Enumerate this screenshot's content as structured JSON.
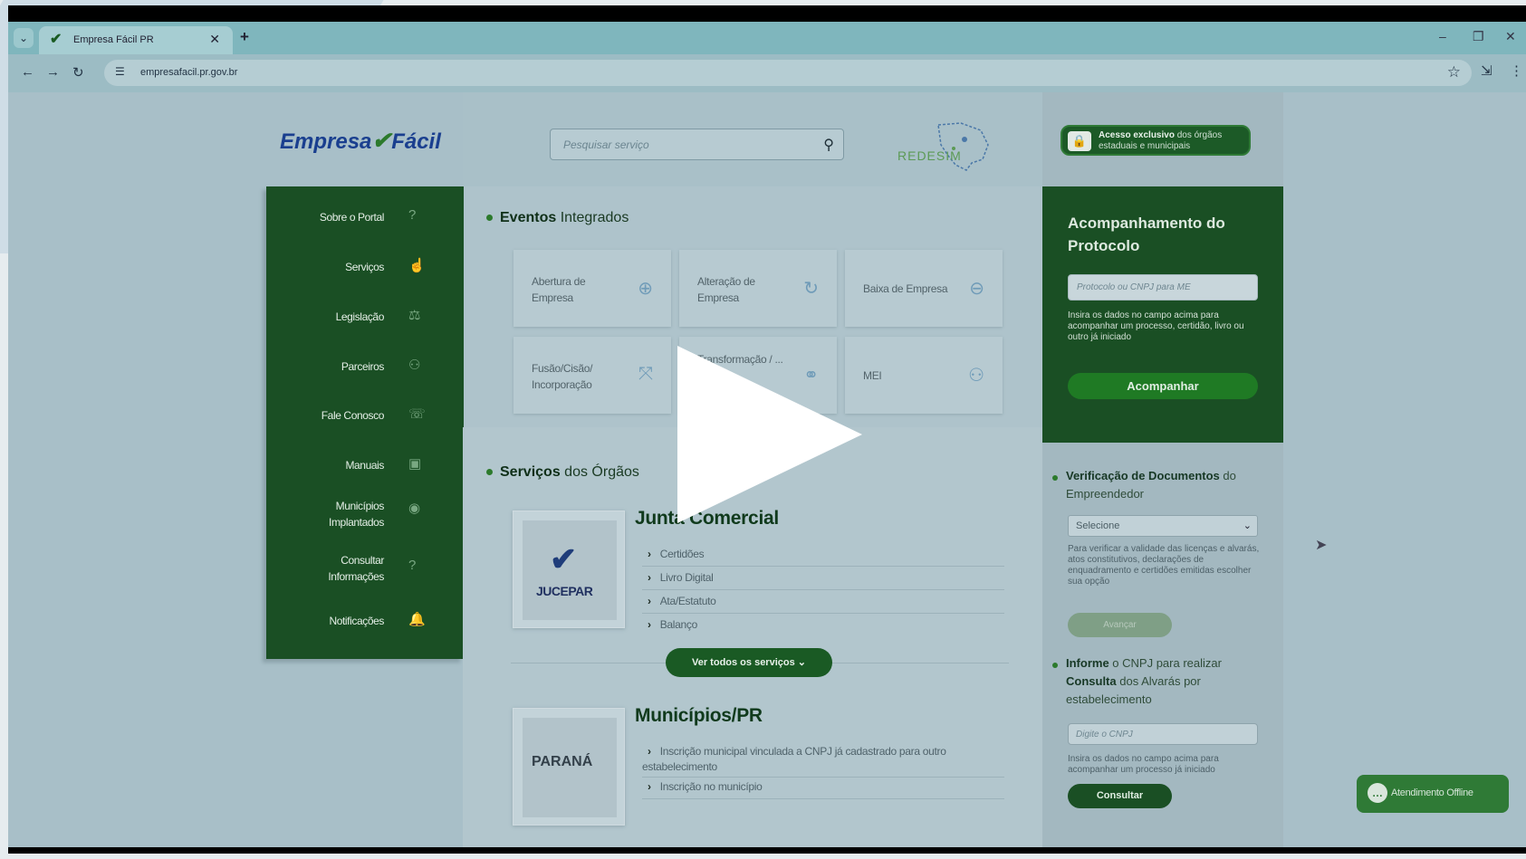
{
  "browser": {
    "tab_title": "Empresa Fácil PR",
    "url": "empresafacil.pr.gov.br"
  },
  "header": {
    "logo_part1": "Empresa",
    "logo_part2": "Fácil",
    "search_placeholder": "Pesquisar serviço",
    "redesim_label": "REDESIM",
    "acesso_bold": "Acesso exclusivo",
    "acesso_rest": "dos órgãos estaduais e municipais"
  },
  "sidebar": {
    "items": [
      {
        "label": "Sobre o Portal",
        "icon": "?"
      },
      {
        "label": "Serviços",
        "icon": "☝"
      },
      {
        "label": "Legislação",
        "icon": "⚖"
      },
      {
        "label": "Parceiros",
        "icon": "⚇"
      },
      {
        "label": "Fale Conosco",
        "icon": "☏"
      },
      {
        "label": "Manuais",
        "icon": "▣"
      },
      {
        "label": "Municípios Implantados",
        "icon": "◉"
      },
      {
        "label": "Consultar Informações",
        "icon": "?"
      },
      {
        "label": "Notificações",
        "icon": "🔔"
      }
    ]
  },
  "eventos": {
    "title_bold": "Eventos",
    "title_rest": "Integrados",
    "cards": [
      {
        "label": "Abertura de Empresa",
        "icon": "⊕"
      },
      {
        "label": "Alteração de Empresa",
        "icon": "↻"
      },
      {
        "label": "Baixa de Empresa",
        "icon": "⊖"
      },
      {
        "label": "Fusão/Cisão/ Incorporação",
        "icon": "⤧"
      },
      {
        "label": "Transformação / ... de ...",
        "icon": "⚭"
      },
      {
        "label": "MEI",
        "icon": "⚇"
      }
    ]
  },
  "orgaos": {
    "title_bold": "Serviços",
    "title_rest": "dos Órgãos",
    "junta": {
      "title": "Junta Comercial",
      "logo_text": "JUCEPAR",
      "links": [
        "Certidões",
        "Livro Digital",
        "Ata/Estatuto",
        "Balanço"
      ]
    },
    "ver_todos": "Ver todos os serviços",
    "municipios": {
      "title": "Municípios/PR",
      "logo_text": "PARANÁ",
      "links": [
        "Inscrição municipal vinculada a CNPJ já cadastrado para outro estabelecimento",
        "Inscrição no município"
      ]
    }
  },
  "protocolo": {
    "title": "Acompanhamento do Protocolo",
    "input_placeholder": "Protocolo ou CNPJ para ME",
    "help": "Insira os dados no campo acima para acompanhar um processo, certidão, livro ou outro já iniciado",
    "button": "Acompanhar"
  },
  "verificacao": {
    "title_bold": "Verificação de Documentos",
    "title_rest": "do Empreendedor",
    "select_value": "Selecione",
    "help": "Para verificar a validade das licenças e alvarás, atos constitutivos, declarações de enquadramento e certidões emitidas escolher sua opção",
    "button": "Avançar"
  },
  "alvaras": {
    "title_part1": "Informe",
    "title_part2": "o CNPJ para realizar",
    "title_part3": "Consulta",
    "title_part4": "dos Alvarás por estabelecimento",
    "input_placeholder": "Digite o CNPJ",
    "help": "Insira os dados no campo acima para acompanhar um processo já iniciado",
    "button": "Consultar"
  },
  "chat": {
    "label": "Atendimento Offline"
  },
  "colors": {
    "green_dark": "#1a4f24",
    "green_button": "#1f7a24",
    "logo_blue": "#1a3f8f"
  }
}
